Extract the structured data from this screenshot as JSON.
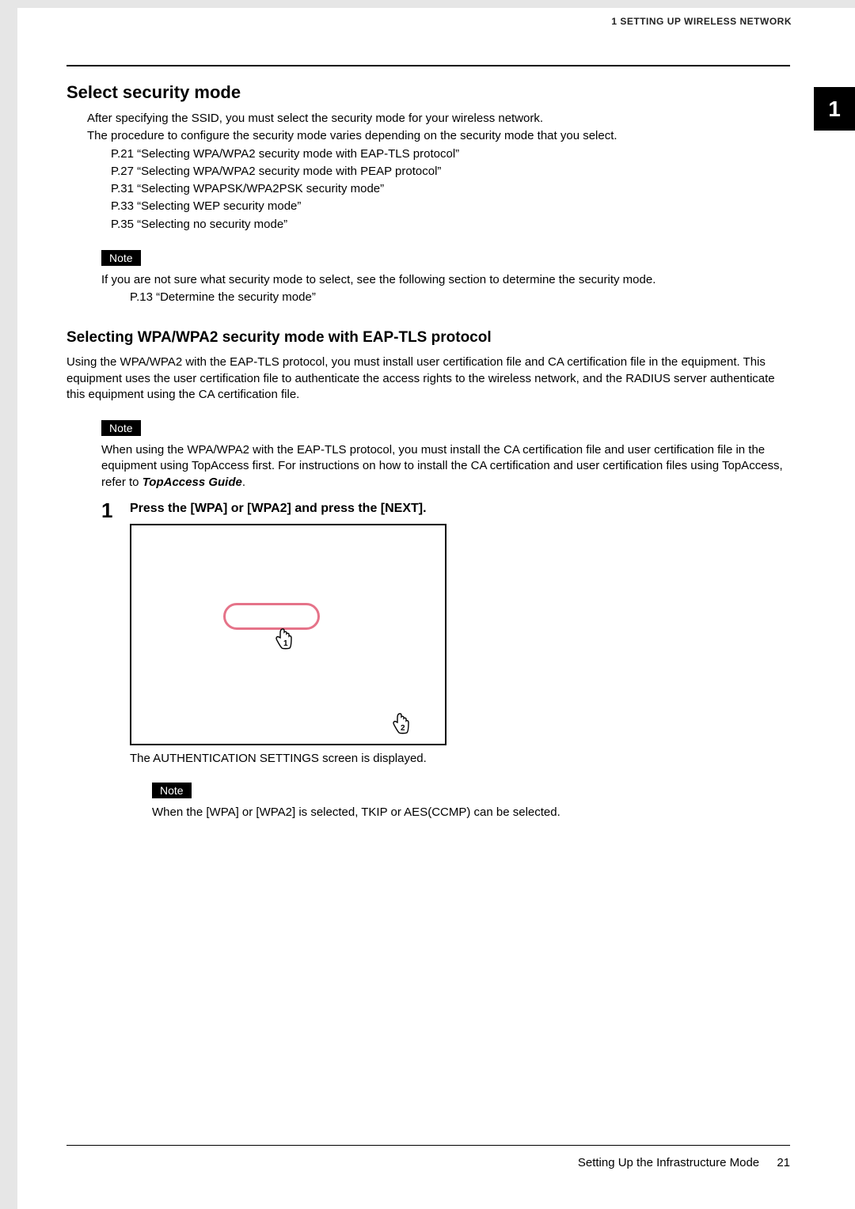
{
  "header": {
    "running_title": "1 SETTING UP WIRELESS NETWORK",
    "chapter_tab": "1"
  },
  "section": {
    "heading": "Select security mode",
    "intro_1": "After specifying the SSID, you must select the security mode for your wireless network.",
    "intro_2": "The procedure to configure the security mode varies depending on the security mode that you select.",
    "refs": [
      "P.21 “Selecting WPA/WPA2 security mode with EAP-TLS protocol”",
      "P.27 “Selecting WPA/WPA2 security mode with PEAP protocol”",
      "P.31 “Selecting WPAPSK/WPA2PSK security mode”",
      "P.33 “Selecting WEP security mode”",
      "P.35 “Selecting no security mode”"
    ],
    "note_label": "Note",
    "note_1_text": "If you are not sure what security mode to select, see the following section to determine the security mode.",
    "note_1_ref": "P.13 “Determine the security mode”"
  },
  "subsection": {
    "heading": "Selecting WPA/WPA2 security mode with EAP-TLS protocol",
    "body": "Using the WPA/WPA2 with the EAP-TLS protocol, you must install user certification file and CA certification file in the equipment. This equipment uses the user certification file to authenticate the access rights to the wireless network, and the RADIUS server authenticate this equipment using the CA certification file.",
    "note_label": "Note",
    "note_prefix": "When using the WPA/WPA2 with the EAP-TLS protocol, you must install the CA certification file and user certification file in the equipment using TopAccess first. For instructions on how to install the CA certification and user certification files using TopAccess, refer to ",
    "note_guide": "TopAccess Guide",
    "note_suffix": "."
  },
  "step1": {
    "number": "1",
    "title": "Press the [WPA] or [WPA2] and press the [NEXT].",
    "caption": "The AUTHENTICATION SETTINGS screen is displayed.",
    "note_label": "Note",
    "note_text": "When the [WPA] or [WPA2] is selected, TKIP or AES(CCMP) can be selected."
  },
  "footer": {
    "section_title": "Setting Up the Infrastructure Mode",
    "page_number": "21"
  }
}
